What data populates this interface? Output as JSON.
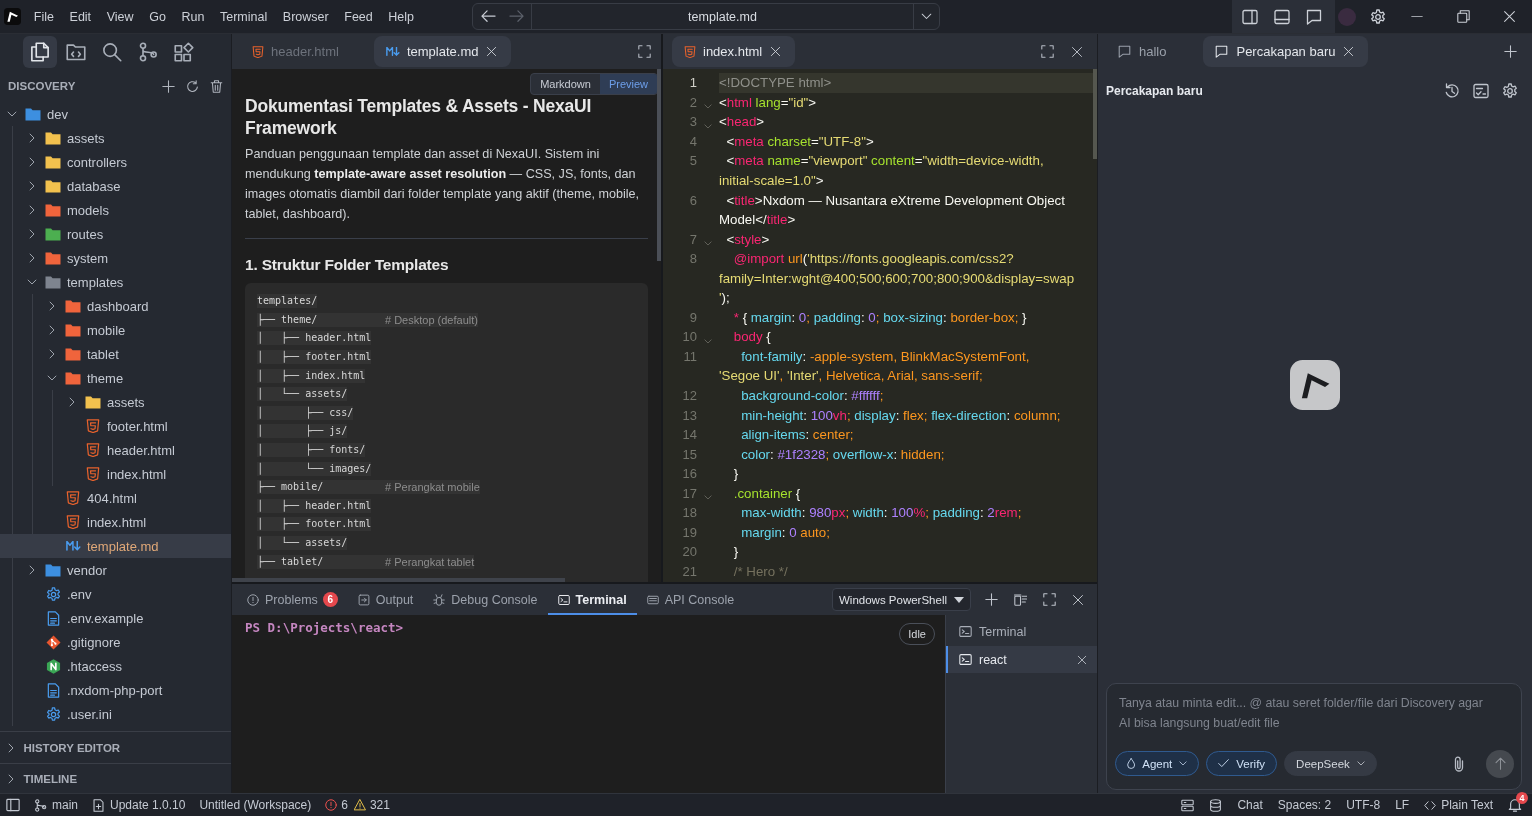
{
  "title_bar": {
    "menu": [
      "File",
      "Edit",
      "View",
      "Go",
      "Run",
      "Terminal",
      "Browser",
      "Feed",
      "Help"
    ],
    "command_center": {
      "value": "template.md",
      "back": {
        "disabled": false
      },
      "forward": {
        "disabled": true
      }
    }
  },
  "activity_bar": [
    {
      "kind": "explorer",
      "selected": true
    },
    {
      "kind": "folders",
      "selected": false
    },
    {
      "kind": "search",
      "selected": false
    },
    {
      "kind": "source_control",
      "selected": false
    },
    {
      "kind": "extensions",
      "selected": false
    }
  ],
  "sidebar": {
    "title": "DISCOVERY",
    "tree": [
      {
        "label": "dev",
        "kind": "folder",
        "color": "#3d8fe0",
        "expanded": true,
        "selected": false,
        "children": [
          {
            "label": "assets",
            "kind": "folder",
            "color": "#f2c14e",
            "expanded": false,
            "selected": false
          },
          {
            "label": "controllers",
            "kind": "folder",
            "color": "#f2c14e",
            "expanded": false,
            "selected": false
          },
          {
            "label": "database",
            "kind": "folder",
            "color": "#f2c14e",
            "expanded": false,
            "selected": false
          },
          {
            "label": "models",
            "kind": "folder",
            "color": "#f0643c",
            "expanded": false,
            "selected": false
          },
          {
            "label": "routes",
            "kind": "folder",
            "color": "#4caf50",
            "expanded": false,
            "selected": false
          },
          {
            "label": "system",
            "kind": "folder",
            "color": "#f0643c",
            "expanded": false,
            "selected": false
          },
          {
            "label": "templates",
            "kind": "folder",
            "color": "#7e848f",
            "expanded": true,
            "selected": false,
            "children": [
              {
                "label": "dashboard",
                "kind": "folder",
                "color": "#f0643c",
                "expanded": false,
                "selected": false
              },
              {
                "label": "mobile",
                "kind": "folder",
                "color": "#f0643c",
                "expanded": false,
                "selected": false
              },
              {
                "label": "tablet",
                "kind": "folder",
                "color": "#f0643c",
                "expanded": false,
                "selected": false
              },
              {
                "label": "theme",
                "kind": "folder",
                "color": "#f0643c",
                "expanded": true,
                "selected": false,
                "children": [
                  {
                    "label": "assets",
                    "kind": "folder",
                    "color": "#f2c14e",
                    "expanded": false,
                    "selected": false
                  },
                  {
                    "label": "footer.html",
                    "kind": "html",
                    "selected": false
                  },
                  {
                    "label": "header.html",
                    "kind": "html",
                    "selected": false
                  },
                  {
                    "label": "index.html",
                    "kind": "html",
                    "selected": false
                  }
                ]
              },
              {
                "label": "404.html",
                "kind": "html",
                "selected": false
              },
              {
                "label": "index.html",
                "kind": "html",
                "selected": false
              },
              {
                "label": "template.md",
                "kind": "markdown",
                "selected": true
              }
            ]
          },
          {
            "label": "vendor",
            "kind": "folder",
            "color": "#3d8fe0",
            "expanded": false,
            "selected": false
          },
          {
            "label": ".env",
            "kind": "settings",
            "selected": false
          },
          {
            "label": ".env.example",
            "kind": "text",
            "selected": false
          },
          {
            "label": ".gitignore",
            "kind": "git",
            "selected": false
          },
          {
            "label": ".htaccess",
            "kind": "config",
            "selected": false
          },
          {
            "label": ".nxdom-php-port",
            "kind": "text",
            "selected": false
          },
          {
            "label": ".user.ini",
            "kind": "settings",
            "selected": false
          }
        ]
      }
    ],
    "sections": [
      {
        "title": "HISTORY EDITOR",
        "expanded": false
      },
      {
        "title": "TIMELINE",
        "expanded": false
      }
    ]
  },
  "editor_left": {
    "tabs": [
      {
        "label": "header.html",
        "kind": "html",
        "selected": false
      },
      {
        "label": "template.md",
        "kind": "markdown",
        "selected": true
      }
    ],
    "view_toggle": [
      {
        "label": "Markdown",
        "selected": false
      },
      {
        "label": "Preview",
        "selected": true
      }
    ],
    "preview": {
      "heading": "Dokumentasi Templates & Assets - NexaUI Framework",
      "intro": "Panduan penggunaan template dan asset di NexaUI. Sistem ini mendukung **template-aware asset resolution** — CSS, JS, fonts, dan images otomatis diambil dari folder template yang aktif (theme, mobile, tablet, dashboard).",
      "section_heading": "1. Struktur Folder Templates",
      "code_block": [
        {
          "code": "templates/"
        },
        {
          "code": "├── theme/",
          "comment": "# Desktop (default)"
        },
        {
          "code": "│   ├── header.html"
        },
        {
          "code": "│   ├── footer.html"
        },
        {
          "code": "│   ├── index.html"
        },
        {
          "code": "│   └── assets/"
        },
        {
          "code": "│       ├── css/"
        },
        {
          "code": "│       ├── js/"
        },
        {
          "code": "│       ├── fonts/"
        },
        {
          "code": "│       └── images/"
        },
        {
          "code": "├── mobile/",
          "comment": "# Perangkat mobile"
        },
        {
          "code": "│   ├── header.html"
        },
        {
          "code": "│   ├── footer.html"
        },
        {
          "code": "│   └── assets/"
        },
        {
          "code": "├── tablet/",
          "comment": "# Perangkat tablet"
        }
      ]
    }
  },
  "editor_right": {
    "tabs": [
      {
        "label": "index.html",
        "kind": "html",
        "selected": true
      }
    ],
    "lines": [
      {
        "number": "1",
        "current": true,
        "foldable": false,
        "rows": [
          {
            "tokens": [
              {
                "text": "<!DOCTYPE html>",
                "kind": "doctype"
              }
            ]
          }
        ]
      },
      {
        "number": "2",
        "current": false,
        "foldable": true,
        "rows": [
          {
            "tokens": [
              {
                "text": "<",
                "kind": "punct"
              },
              {
                "text": "html",
                "kind": "tag"
              },
              {
                "text": " lang",
                "kind": "attr"
              },
              {
                "text": "=",
                "kind": "punct"
              },
              {
                "text": "\"id\"",
                "kind": "string"
              },
              {
                "text": ">",
                "kind": "punct"
              }
            ]
          }
        ]
      },
      {
        "number": "3",
        "current": false,
        "foldable": true,
        "rows": [
          {
            "tokens": [
              {
                "text": "<",
                "kind": "punct"
              },
              {
                "text": "head",
                "kind": "tag"
              },
              {
                "text": ">",
                "kind": "punct"
              }
            ]
          }
        ]
      },
      {
        "number": "4",
        "current": false,
        "foldable": false,
        "rows": [
          {
            "tokens": [
              {
                "text": "  <",
                "kind": "punct"
              },
              {
                "text": "meta",
                "kind": "tag"
              },
              {
                "text": " charset",
                "kind": "attr"
              },
              {
                "text": "=",
                "kind": "punct"
              },
              {
                "text": "\"UTF-8\"",
                "kind": "string"
              },
              {
                "text": ">",
                "kind": "punct"
              }
            ]
          }
        ]
      },
      {
        "number": "5",
        "current": false,
        "foldable": false,
        "rows": [
          {
            "tokens": [
              {
                "text": "  <",
                "kind": "punct"
              },
              {
                "text": "meta",
                "kind": "tag"
              },
              {
                "text": " name",
                "kind": "attr"
              },
              {
                "text": "=",
                "kind": "punct"
              },
              {
                "text": "\"viewport\"",
                "kind": "string"
              },
              {
                "text": " content",
                "kind": "attr"
              },
              {
                "text": "=",
                "kind": "punct"
              },
              {
                "text": "\"width=device-width,",
                "kind": "string"
              }
            ]
          },
          {
            "tokens": [
              {
                "text": "initial-scale=1.0\"",
                "kind": "string"
              },
              {
                "text": ">",
                "kind": "punct"
              }
            ]
          }
        ]
      },
      {
        "number": "6",
        "current": false,
        "foldable": false,
        "rows": [
          {
            "tokens": [
              {
                "text": "  <",
                "kind": "punct"
              },
              {
                "text": "title",
                "kind": "tag"
              },
              {
                "text": ">",
                "kind": "punct"
              },
              {
                "text": "Nxdom — Nusantara eXtreme Development Object",
                "kind": "text"
              }
            ]
          },
          {
            "tokens": [
              {
                "text": "Model",
                "kind": "text"
              },
              {
                "text": "</",
                "kind": "punct"
              },
              {
                "text": "title",
                "kind": "tag"
              },
              {
                "text": ">",
                "kind": "punct"
              }
            ]
          }
        ]
      },
      {
        "number": "7",
        "current": false,
        "foldable": true,
        "rows": [
          {
            "tokens": [
              {
                "text": "  <",
                "kind": "punct"
              },
              {
                "text": "style",
                "kind": "tag"
              },
              {
                "text": ">",
                "kind": "punct"
              }
            ]
          }
        ]
      },
      {
        "number": "8",
        "current": false,
        "foldable": false,
        "rows": [
          {
            "tokens": [
              {
                "text": "    @import",
                "kind": "at"
              },
              {
                "text": " url",
                "kind": "func"
              },
              {
                "text": "(",
                "kind": "punct"
              },
              {
                "text": "'https://fonts.googleapis.com/css2?",
                "kind": "string"
              }
            ]
          },
          {
            "tokens": [
              {
                "text": "family=Inter:wght@400;500;600;700;800;900&display=swap",
                "kind": "string"
              }
            ]
          },
          {
            "tokens": [
              {
                "text": "'",
                "kind": "string"
              },
              {
                "text": ");",
                "kind": "punct"
              }
            ]
          }
        ]
      },
      {
        "number": "9",
        "current": false,
        "foldable": false,
        "rows": [
          {
            "tokens": [
              {
                "text": "    *",
                "kind": "selector"
              },
              {
                "text": " { ",
                "kind": "punct"
              },
              {
                "text": "margin",
                "kind": "prop"
              },
              {
                "text": ": ",
                "kind": "punct"
              },
              {
                "text": "0",
                "kind": "number"
              },
              {
                "text": "; ",
                "kind": "value"
              },
              {
                "text": "padding",
                "kind": "prop"
              },
              {
                "text": ": ",
                "kind": "punct"
              },
              {
                "text": "0",
                "kind": "number"
              },
              {
                "text": "; ",
                "kind": "value"
              },
              {
                "text": "box-sizing",
                "kind": "prop"
              },
              {
                "text": ": ",
                "kind": "punct"
              },
              {
                "text": "border-box;",
                "kind": "value"
              },
              {
                "text": " }",
                "kind": "punct"
              }
            ]
          }
        ]
      },
      {
        "number": "10",
        "current": false,
        "foldable": true,
        "rows": [
          {
            "tokens": [
              {
                "text": "    body",
                "kind": "selector"
              },
              {
                "text": " {",
                "kind": "punct"
              }
            ]
          }
        ]
      },
      {
        "number": "11",
        "current": false,
        "foldable": false,
        "rows": [
          {
            "tokens": [
              {
                "text": "      font-family",
                "kind": "prop"
              },
              {
                "text": ": ",
                "kind": "punct"
              },
              {
                "text": "-apple-system, BlinkMacSystemFont,",
                "kind": "value"
              }
            ]
          },
          {
            "tokens": [
              {
                "text": "'Segoe UI'",
                "kind": "string"
              },
              {
                "text": ", ",
                "kind": "value"
              },
              {
                "text": "'Inter'",
                "kind": "string"
              },
              {
                "text": ", Helvetica, Arial, sans-serif;",
                "kind": "value"
              }
            ]
          }
        ]
      },
      {
        "number": "12",
        "current": false,
        "foldable": false,
        "rows": [
          {
            "tokens": [
              {
                "text": "      background-color",
                "kind": "prop"
              },
              {
                "text": ": ",
                "kind": "punct"
              },
              {
                "text": "#ffffff",
                "kind": "number"
              },
              {
                "text": ";",
                "kind": "value"
              }
            ]
          }
        ]
      },
      {
        "number": "13",
        "current": false,
        "foldable": false,
        "rows": [
          {
            "tokens": [
              {
                "text": "      min-height",
                "kind": "prop"
              },
              {
                "text": ": ",
                "kind": "punct"
              },
              {
                "text": "100",
                "kind": "number"
              },
              {
                "text": "vh",
                "kind": "unit"
              },
              {
                "text": "; ",
                "kind": "value"
              },
              {
                "text": "display",
                "kind": "prop"
              },
              {
                "text": ": ",
                "kind": "punct"
              },
              {
                "text": "flex; ",
                "kind": "value"
              },
              {
                "text": "flex-direction",
                "kind": "prop"
              },
              {
                "text": ": ",
                "kind": "punct"
              },
              {
                "text": "column;",
                "kind": "value"
              }
            ]
          }
        ]
      },
      {
        "number": "14",
        "current": false,
        "foldable": false,
        "rows": [
          {
            "tokens": [
              {
                "text": "      align-items",
                "kind": "prop"
              },
              {
                "text": ": ",
                "kind": "punct"
              },
              {
                "text": "center;",
                "kind": "value"
              }
            ]
          }
        ]
      },
      {
        "number": "15",
        "current": false,
        "foldable": false,
        "rows": [
          {
            "tokens": [
              {
                "text": "      color",
                "kind": "prop"
              },
              {
                "text": ": ",
                "kind": "punct"
              },
              {
                "text": "#1f2328",
                "kind": "number"
              },
              {
                "text": "; ",
                "kind": "value"
              },
              {
                "text": "overflow-x",
                "kind": "prop"
              },
              {
                "text": ": ",
                "kind": "punct"
              },
              {
                "text": "hidden;",
                "kind": "value"
              }
            ]
          }
        ]
      },
      {
        "number": "16",
        "current": false,
        "foldable": false,
        "rows": [
          {
            "tokens": [
              {
                "text": "    }",
                "kind": "punct"
              }
            ]
          }
        ]
      },
      {
        "number": "17",
        "current": false,
        "foldable": true,
        "rows": [
          {
            "tokens": [
              {
                "text": "    .container",
                "kind": "class"
              },
              {
                "text": " {",
                "kind": "punct"
              }
            ]
          }
        ]
      },
      {
        "number": "18",
        "current": false,
        "foldable": false,
        "rows": [
          {
            "tokens": [
              {
                "text": "      max-width",
                "kind": "prop"
              },
              {
                "text": ": ",
                "kind": "punct"
              },
              {
                "text": "980",
                "kind": "number"
              },
              {
                "text": "px",
                "kind": "unit"
              },
              {
                "text": "; ",
                "kind": "value"
              },
              {
                "text": "width",
                "kind": "prop"
              },
              {
                "text": ": ",
                "kind": "punct"
              },
              {
                "text": "100",
                "kind": "number"
              },
              {
                "text": "%",
                "kind": "unit"
              },
              {
                "text": "; ",
                "kind": "value"
              },
              {
                "text": "padding",
                "kind": "prop"
              },
              {
                "text": ": ",
                "kind": "punct"
              },
              {
                "text": "2",
                "kind": "number"
              },
              {
                "text": "rem",
                "kind": "unit"
              },
              {
                "text": ";",
                "kind": "value"
              }
            ]
          }
        ]
      },
      {
        "number": "19",
        "current": false,
        "foldable": false,
        "rows": [
          {
            "tokens": [
              {
                "text": "      margin",
                "kind": "prop"
              },
              {
                "text": ": ",
                "kind": "punct"
              },
              {
                "text": "0",
                "kind": "number"
              },
              {
                "text": " auto;",
                "kind": "value"
              }
            ]
          }
        ]
      },
      {
        "number": "20",
        "current": false,
        "foldable": false,
        "rows": [
          {
            "tokens": [
              {
                "text": "    }",
                "kind": "punct"
              }
            ]
          }
        ]
      },
      {
        "number": "21",
        "current": false,
        "foldable": false,
        "rows": [
          {
            "tokens": [
              {
                "text": "    /* Hero */",
                "kind": "comment"
              }
            ]
          }
        ]
      }
    ]
  },
  "panel": {
    "tabs": [
      {
        "label": "Problems",
        "kind": "problems",
        "badge": "6",
        "selected": false
      },
      {
        "label": "Output",
        "kind": "output",
        "selected": false
      },
      {
        "label": "Debug Console",
        "kind": "debug",
        "selected": false
      },
      {
        "label": "Terminal",
        "kind": "terminal",
        "selected": true
      },
      {
        "label": "API Console",
        "kind": "api",
        "selected": false
      }
    ],
    "shell": "Windows PowerShell",
    "terminal": {
      "prompt": "PS D:\\Projects\\react>",
      "status": "Idle"
    },
    "sessions": [
      {
        "label": "Terminal",
        "selected": false
      },
      {
        "label": "react",
        "selected": true
      }
    ]
  },
  "chat": {
    "tabs": [
      {
        "label": "hallo",
        "selected": false
      },
      {
        "label": "Percakapan baru",
        "selected": true
      }
    ],
    "title": "Percakapan baru",
    "input": {
      "placeholder": "Tanya atau minta edit... @ atau seret folder/file dari Discovery agar AI bisa langsung buat/edit file"
    },
    "chips": [
      {
        "label": "Agent",
        "kind": "mode",
        "on": true
      },
      {
        "label": "Verify",
        "kind": "toggle",
        "on": true
      },
      {
        "label": "DeepSeek",
        "kind": "model",
        "on": false
      }
    ],
    "send": {
      "disabled": true
    }
  },
  "status_bar": {
    "left": [
      {
        "kind": "branch",
        "text": "main"
      },
      {
        "kind": "update",
        "text": "Update 1.0.10"
      },
      {
        "kind": "plain",
        "text": "Untitled (Workspace)"
      }
    ],
    "problems": {
      "errors": "6",
      "warnings": "321"
    },
    "right": [
      {
        "kind": "plain",
        "text": "Chat"
      },
      {
        "kind": "plain",
        "text": "Spaces: 2"
      },
      {
        "kind": "plain",
        "text": "UTF-8"
      },
      {
        "kind": "plain",
        "text": "LF"
      },
      {
        "kind": "code",
        "text": "Plain Text"
      }
    ],
    "notifications": "4"
  }
}
